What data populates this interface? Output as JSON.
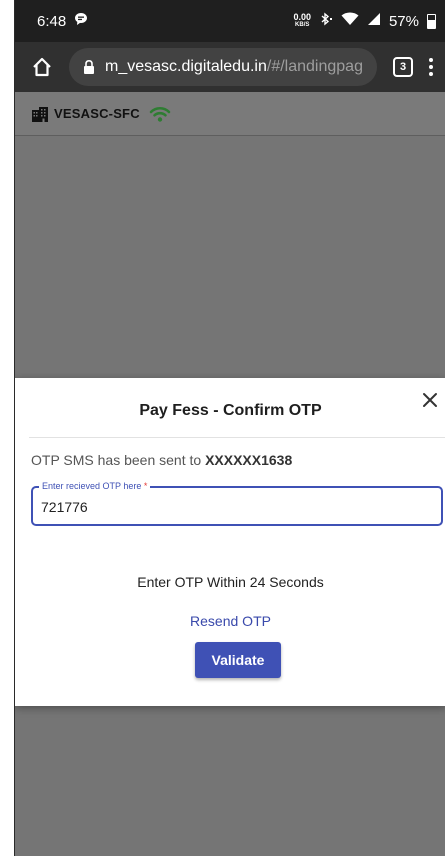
{
  "status_bar": {
    "time": "6:48",
    "net_speed_value": "0.00",
    "net_speed_unit": "KB/S",
    "battery": "57%"
  },
  "browser": {
    "url_host": "m_vesasc.digitaledu.in",
    "url_path": "/#/landingpag",
    "tab_count": "3"
  },
  "app": {
    "title": "VESASC-SFC",
    "wifi_color": "#2e7d32"
  },
  "dialog": {
    "title": "Pay Fess - Confirm OTP",
    "otp_sent_prefix": "OTP SMS has been sent to ",
    "otp_sent_number": "XXXXXX1638",
    "otp_label": "Enter recieved OTP here",
    "otp_required_mark": "*",
    "otp_value": "721776",
    "timer_text": "Enter OTP Within 24 Seconds",
    "resend_label": "Resend OTP",
    "validate_label": "Validate"
  },
  "colors": {
    "accent": "#3f51b5",
    "overlay": "#757575"
  }
}
